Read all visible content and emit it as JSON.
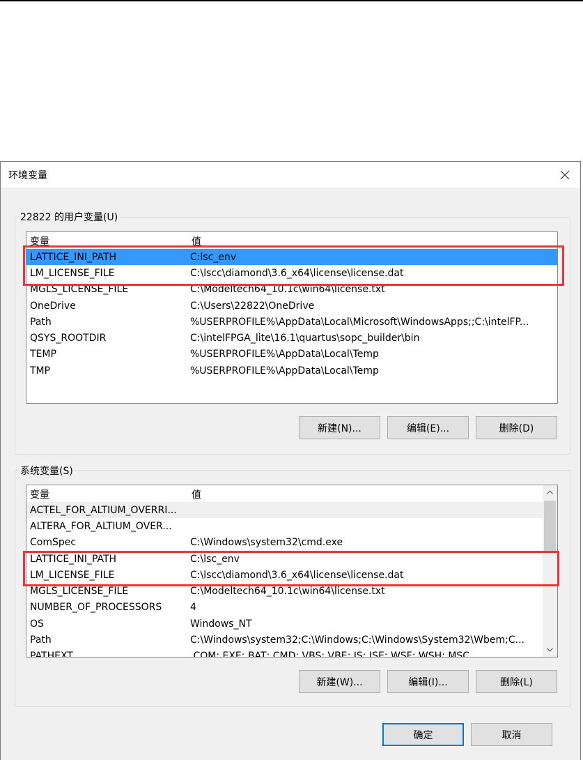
{
  "dialog": {
    "title": "环境变量",
    "user_group_label": "22822 的用户变量(U)",
    "system_group_label": "系统变量(S)",
    "columns": [
      "变量",
      "值"
    ],
    "user_vars": [
      {
        "name": "LATTICE_INI_PATH",
        "value": "C:lsc_env"
      },
      {
        "name": "LM_LICENSE_FILE",
        "value": "C:\\lscc\\diamond\\3.6_x64\\license\\license.dat"
      },
      {
        "name": "MGLS_LICENSE_FILE",
        "value": "C:\\Modeltech64_10.1c\\win64\\license.txt"
      },
      {
        "name": "OneDrive",
        "value": "C:\\Users\\22822\\OneDrive"
      },
      {
        "name": "Path",
        "value": "%USERPROFILE%\\AppData\\Local\\Microsoft\\WindowsApps;;C:\\intelFP..."
      },
      {
        "name": "QSYS_ROOTDIR",
        "value": "C:\\intelFPGA_lite\\16.1\\quartus\\sopc_builder\\bin"
      },
      {
        "name": "TEMP",
        "value": "%USERPROFILE%\\AppData\\Local\\Temp"
      },
      {
        "name": "TMP",
        "value": "%USERPROFILE%\\AppData\\Local\\Temp"
      }
    ],
    "system_vars": [
      {
        "name": "ACTEL_FOR_ALTIUM_OVERRI...",
        "value": ""
      },
      {
        "name": "ALTERA_FOR_ALTIUM_OVER...",
        "value": ""
      },
      {
        "name": "ComSpec",
        "value": "C:\\Windows\\system32\\cmd.exe"
      },
      {
        "name": "LATTICE_INI_PATH",
        "value": "C:\\lsc_env"
      },
      {
        "name": "LM_LICENSE_FILE",
        "value": "C:\\lscc\\diamond\\3.6_x64\\license\\license.dat"
      },
      {
        "name": "MGLS_LICENSE_FILE",
        "value": "C:\\Modeltech64_10.1c\\win64\\license.txt"
      },
      {
        "name": "NUMBER_OF_PROCESSORS",
        "value": "4"
      },
      {
        "name": "OS",
        "value": "Windows_NT"
      },
      {
        "name": "Path",
        "value": "C:\\Windows\\system32;C:\\Windows;C:\\Windows\\System32\\Wbem;C..."
      },
      {
        "name": "PATHEXT",
        "value": ".COM;.EXE;.BAT;.CMD;.VBS;.VBE;.JS;.JSE;.WSF;.WSH;.MSC"
      }
    ],
    "user_buttons": {
      "new": "新建(N)...",
      "edit": "编辑(E)...",
      "delete": "删除(D)"
    },
    "system_buttons": {
      "new": "新建(W)...",
      "edit": "编辑(I)...",
      "delete": "删除(L)"
    },
    "ok_label": "确定",
    "cancel_label": "取消",
    "icons": {
      "close": "close-icon",
      "scroll_up": "chevron-up-icon",
      "scroll_down": "chevron-down-icon"
    }
  },
  "colors": {
    "selection": "#3399ff",
    "highlight_box": "#e8363a",
    "dialog_bg": "#f0f0f0",
    "primary_border": "#0078d7"
  }
}
